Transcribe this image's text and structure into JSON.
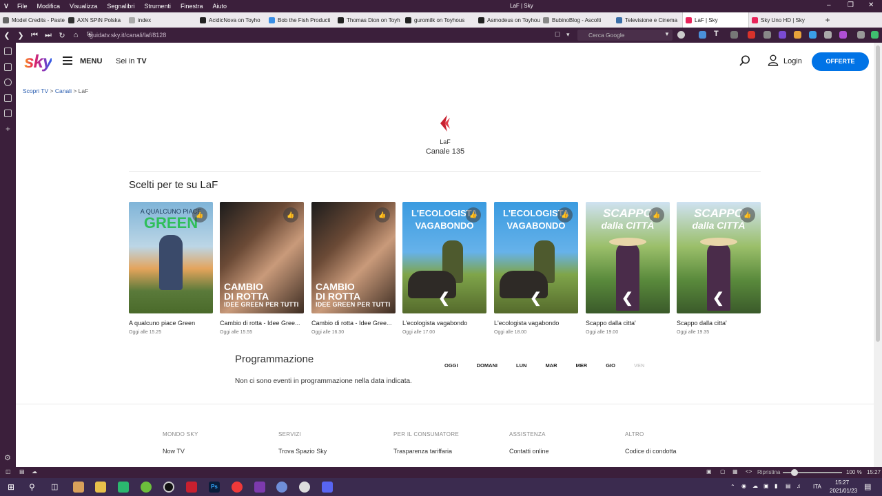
{
  "browser": {
    "menu": [
      "File",
      "Modifica",
      "Visualizza",
      "Segnalibri",
      "Strumenti",
      "Finestra",
      "Aiuto"
    ],
    "window_title": "LaF | Sky",
    "url": "guidatv.sky.it/canali/laf/8128",
    "search_placeholder": "Cerca Google",
    "bookmarks": [
      {
        "label": "Model Credits - Paste",
        "color": "#666"
      },
      {
        "label": "AXN SPiN Polska",
        "color": "#333"
      },
      {
        "label": "index",
        "color": "#aaa"
      },
      {
        "label": "AcidicNova on Toyho",
        "color": "#222"
      },
      {
        "label": "Bob the Fish Producti",
        "color": "#3a8ee6"
      },
      {
        "label": "Thomas Dion on Toyh",
        "color": "#222"
      },
      {
        "label": "guromilk on Toyhous",
        "color": "#222"
      },
      {
        "label": "Asmodeus on Toyhou",
        "color": "#222"
      },
      {
        "label": "BubinoBlog - Ascolti",
        "color": "#888"
      },
      {
        "label": "Televisione e Cinema",
        "color": "#3a6ea8"
      },
      {
        "label": "LaF | Sky",
        "color": "#e8235a",
        "active": true
      },
      {
        "label": "Sky Uno HD | Sky",
        "color": "#e8235a"
      }
    ]
  },
  "header": {
    "logo": "sky",
    "menu_label": "MENU",
    "sei_in": "Sei in",
    "section": "TV",
    "login": "Login",
    "offerte": "OFFERTE"
  },
  "breadcrumb": {
    "items": [
      "Scopri TV",
      "Canali"
    ],
    "current": "LaF"
  },
  "channel": {
    "name": "LaF",
    "number": "Canale 135"
  },
  "picks": {
    "title": "Scelti per te su LaF",
    "cards": [
      {
        "title": "A qualcuno piace Green",
        "time": "Oggi alle 15.25",
        "overlay_top": "A QUALCUNO PIACE",
        "overlay_main": "GREEN",
        "style": "green"
      },
      {
        "title": "Cambio di rotta - Idee Gree...",
        "time": "Oggi alle 15.55",
        "overlay_top": "CAMBIO",
        "overlay_main": "DI ROTTA",
        "overlay_sub": "IDEE GREEN PER TUTTI",
        "style": "rotta"
      },
      {
        "title": "Cambio di rotta - Idee Gree...",
        "time": "Oggi alle 16.30",
        "overlay_top": "CAMBIO",
        "overlay_main": "DI ROTTA",
        "overlay_sub": "IDEE GREEN PER TUTTI",
        "style": "rotta"
      },
      {
        "title": "L'ecologista vagabondo",
        "time": "Oggi alle 17.00",
        "overlay_top": "L'ECOLOGISTA",
        "overlay_main": "VAGABONDO",
        "style": "eco"
      },
      {
        "title": "L'ecologista vagabondo",
        "time": "Oggi alle 18.00",
        "overlay_top": "L'ECOLOGISTA",
        "overlay_main": "VAGABONDO",
        "style": "eco"
      },
      {
        "title": "Scappo dalla citta'",
        "time": "Oggi alle 19.00",
        "overlay_top": "SCAPPO",
        "overlay_main": "dalla CITTÀ",
        "style": "scappo"
      },
      {
        "title": "Scappo dalla citta'",
        "time": "Oggi alle 19.35",
        "overlay_top": "SCAPPO",
        "overlay_main": "dalla CITTÀ",
        "style": "scappo"
      }
    ]
  },
  "schedule": {
    "title": "Programmazione",
    "days": [
      {
        "label": "OGGI",
        "disabled": false
      },
      {
        "label": "DOMANI",
        "disabled": false
      },
      {
        "label": "LUN",
        "disabled": false
      },
      {
        "label": "MAR",
        "disabled": false
      },
      {
        "label": "MER",
        "disabled": false
      },
      {
        "label": "GIO",
        "disabled": false
      },
      {
        "label": "VEN",
        "disabled": true
      }
    ],
    "empty_message": "Non ci sono eventi in programmazione nella data indicata."
  },
  "footer": {
    "columns": [
      {
        "heading": "MONDO SKY",
        "link": "Now TV"
      },
      {
        "heading": "SERVIZI",
        "link": "Trova Spazio Sky"
      },
      {
        "heading": "PER IL CONSUMATORE",
        "link": "Trasparenza tariffaria"
      },
      {
        "heading": "ASSISTENZA",
        "link": "Contatti online"
      },
      {
        "heading": "ALTRO",
        "link": "Codice di condotta"
      }
    ]
  },
  "statusbar": {
    "label": "Ripristina",
    "zoom": "100 %",
    "time": "15:27"
  },
  "taskbar": {
    "lang": "ITA",
    "time": "15:27",
    "date": "2021/01/23"
  },
  "colors": {
    "accent": "#0073e6",
    "browser_chrome": "#3b1f3b",
    "link": "#2a5db0"
  }
}
